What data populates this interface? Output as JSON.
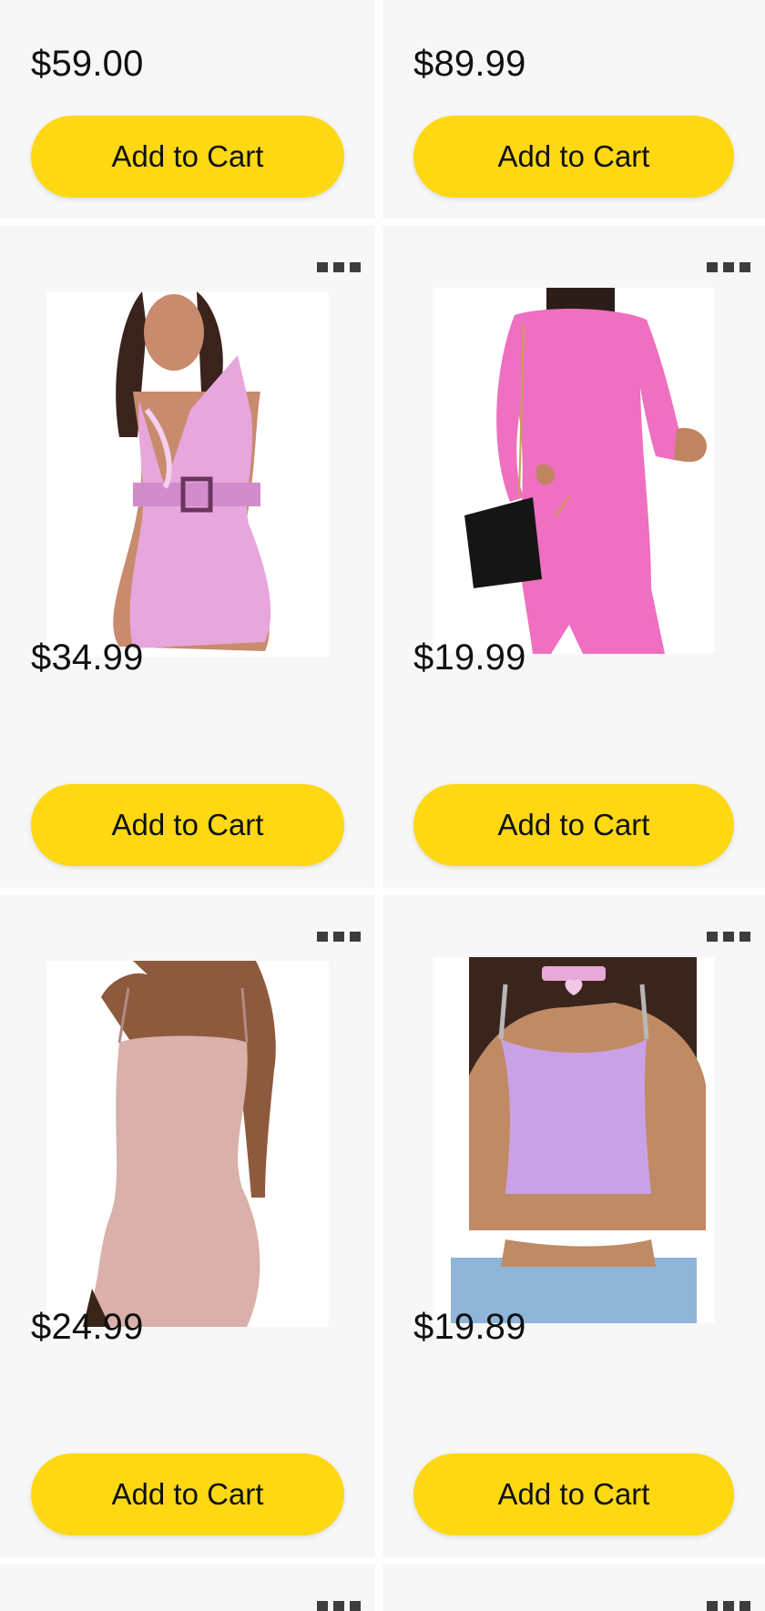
{
  "top_row": [
    {
      "price": "$59.00",
      "button_label": "Add to Cart"
    },
    {
      "price": "$89.99",
      "button_label": "Add to Cart"
    }
  ],
  "products": [
    {
      "price": "$34.99",
      "button_label": "Add to Cart",
      "image": "pink-vinyl-belted-mini-dress",
      "color": "#e7a6dc"
    },
    {
      "price": "$19.99",
      "button_label": "Add to Cart",
      "image": "hot-pink-fuzzy-long-sleeve-dress",
      "color": "#ef6fc0"
    },
    {
      "price": "$24.99",
      "button_label": "Add to Cart",
      "image": "rose-glitter-cami-bodycon-dress",
      "color": "#d9b0aa"
    },
    {
      "price": "$19.89",
      "button_label": "Add to Cart",
      "image": "lavender-fuzzy-chain-crop-top",
      "color": "#c9a2e6"
    }
  ],
  "icons": {
    "more": "more-options-icon"
  },
  "theme": {
    "button_color": "#ffd814",
    "card_background": "#f7f7f7",
    "text_color": "#0f1111"
  }
}
